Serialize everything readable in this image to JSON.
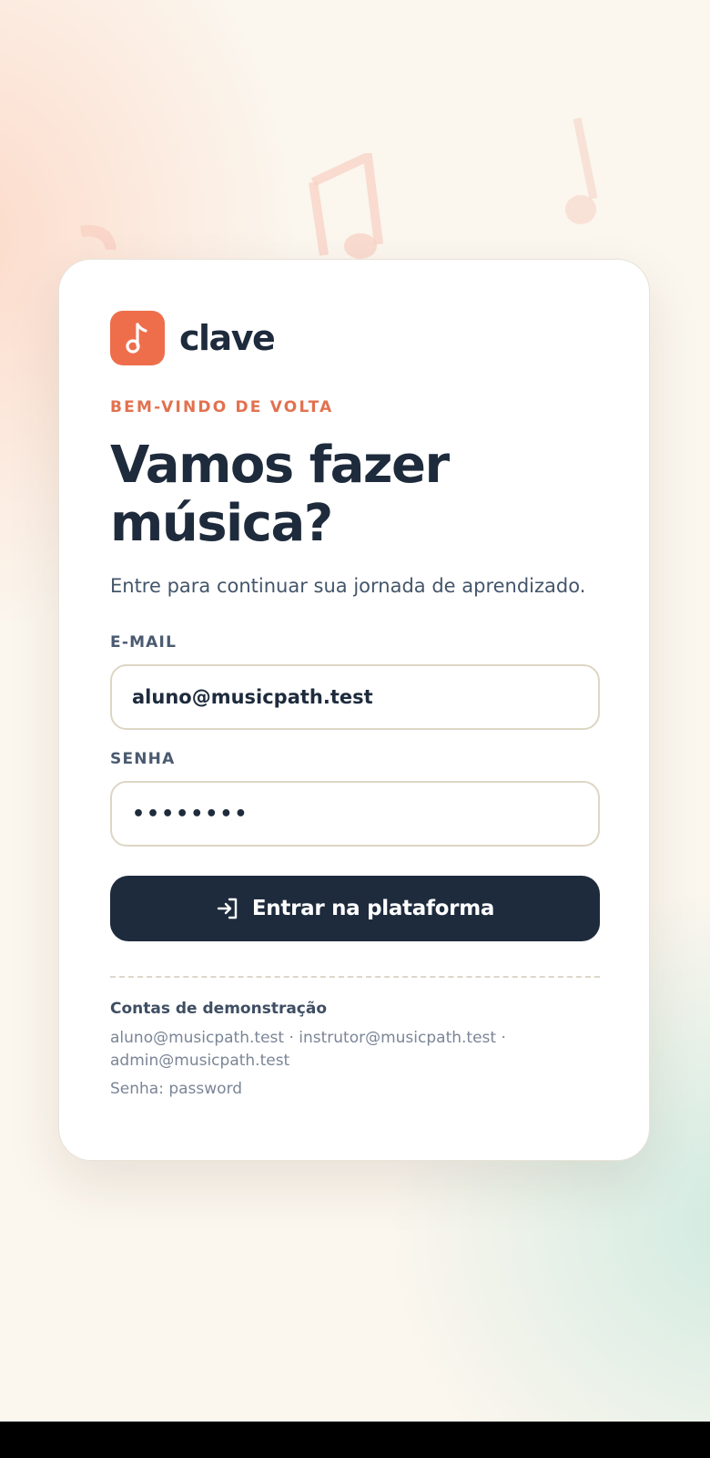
{
  "brand": {
    "name": "clave",
    "icon": "music-note-icon",
    "accent_color": "#ee6e4c"
  },
  "login": {
    "eyebrow": "BEM-VINDO DE VOLTA",
    "headline_line1": "Vamos fazer",
    "headline_line2": "música?",
    "subtitle": "Entre para continuar sua jornada de aprendizado.",
    "email_label": "E-MAIL",
    "email_value": "aluno@musicpath.test",
    "password_label": "SENHA",
    "password_value": "••••••••",
    "submit_label": "Entrar na plataforma",
    "submit_icon": "login-arrow-icon",
    "submit_color": "#1e2b3d"
  },
  "demo": {
    "title": "Contas de demonstração",
    "accounts_line1": "aluno@musicpath.test · instrutor@musicpath.test ·",
    "accounts_line2": "admin@musicpath.test",
    "password_hint": "Senha: password"
  }
}
